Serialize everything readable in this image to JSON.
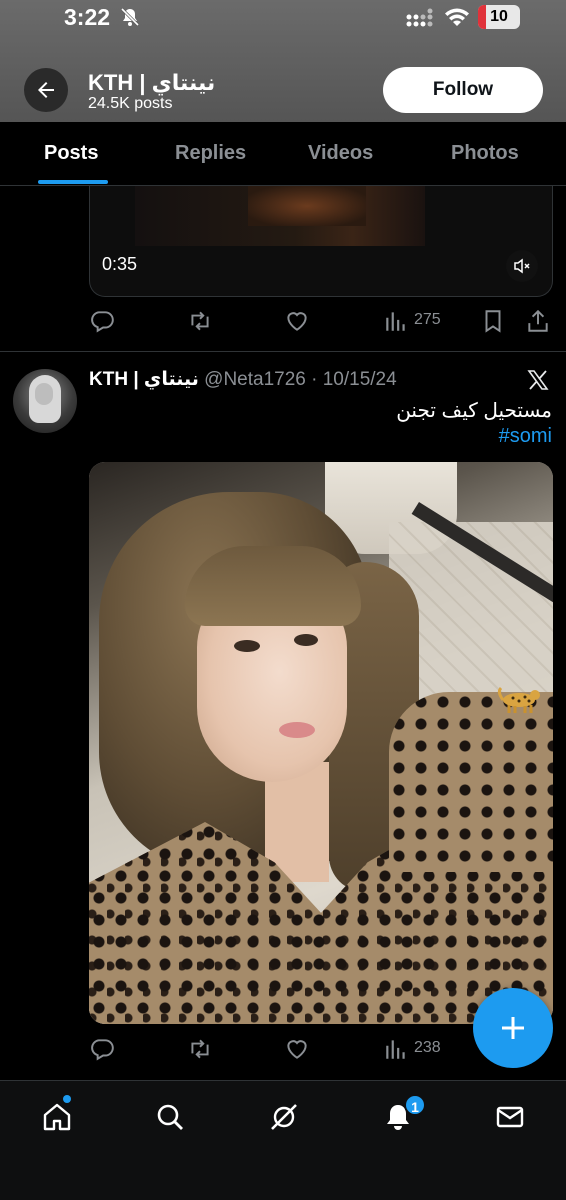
{
  "status_bar": {
    "time": "3:22",
    "battery": "10"
  },
  "header": {
    "profile_name": "KTH | نينتاي",
    "post_count": "24.5K posts",
    "follow_label": "Follow"
  },
  "tabs": [
    {
      "label": "Posts",
      "active": true
    },
    {
      "label": "Replies",
      "active": false
    },
    {
      "label": "Videos",
      "active": false
    },
    {
      "label": "Photos",
      "active": false
    }
  ],
  "post1": {
    "video_duration": "0:35",
    "views": "275"
  },
  "post2": {
    "author_name": "KTH | نينتاي",
    "handle_date": "@Neta1726 · 10/15/24",
    "text": "مستحيل كيف تجنن",
    "hashtag": "#somi",
    "views": "238",
    "photo_emoji": "leopard"
  },
  "bottom_nav": {
    "items": [
      "home-icon",
      "search-icon",
      "grok-icon",
      "notifications-icon",
      "messages-icon"
    ],
    "notification_count": "1"
  },
  "colors": {
    "accent": "#1d9bf0",
    "background": "#000000",
    "muted": "#8b8f94"
  }
}
